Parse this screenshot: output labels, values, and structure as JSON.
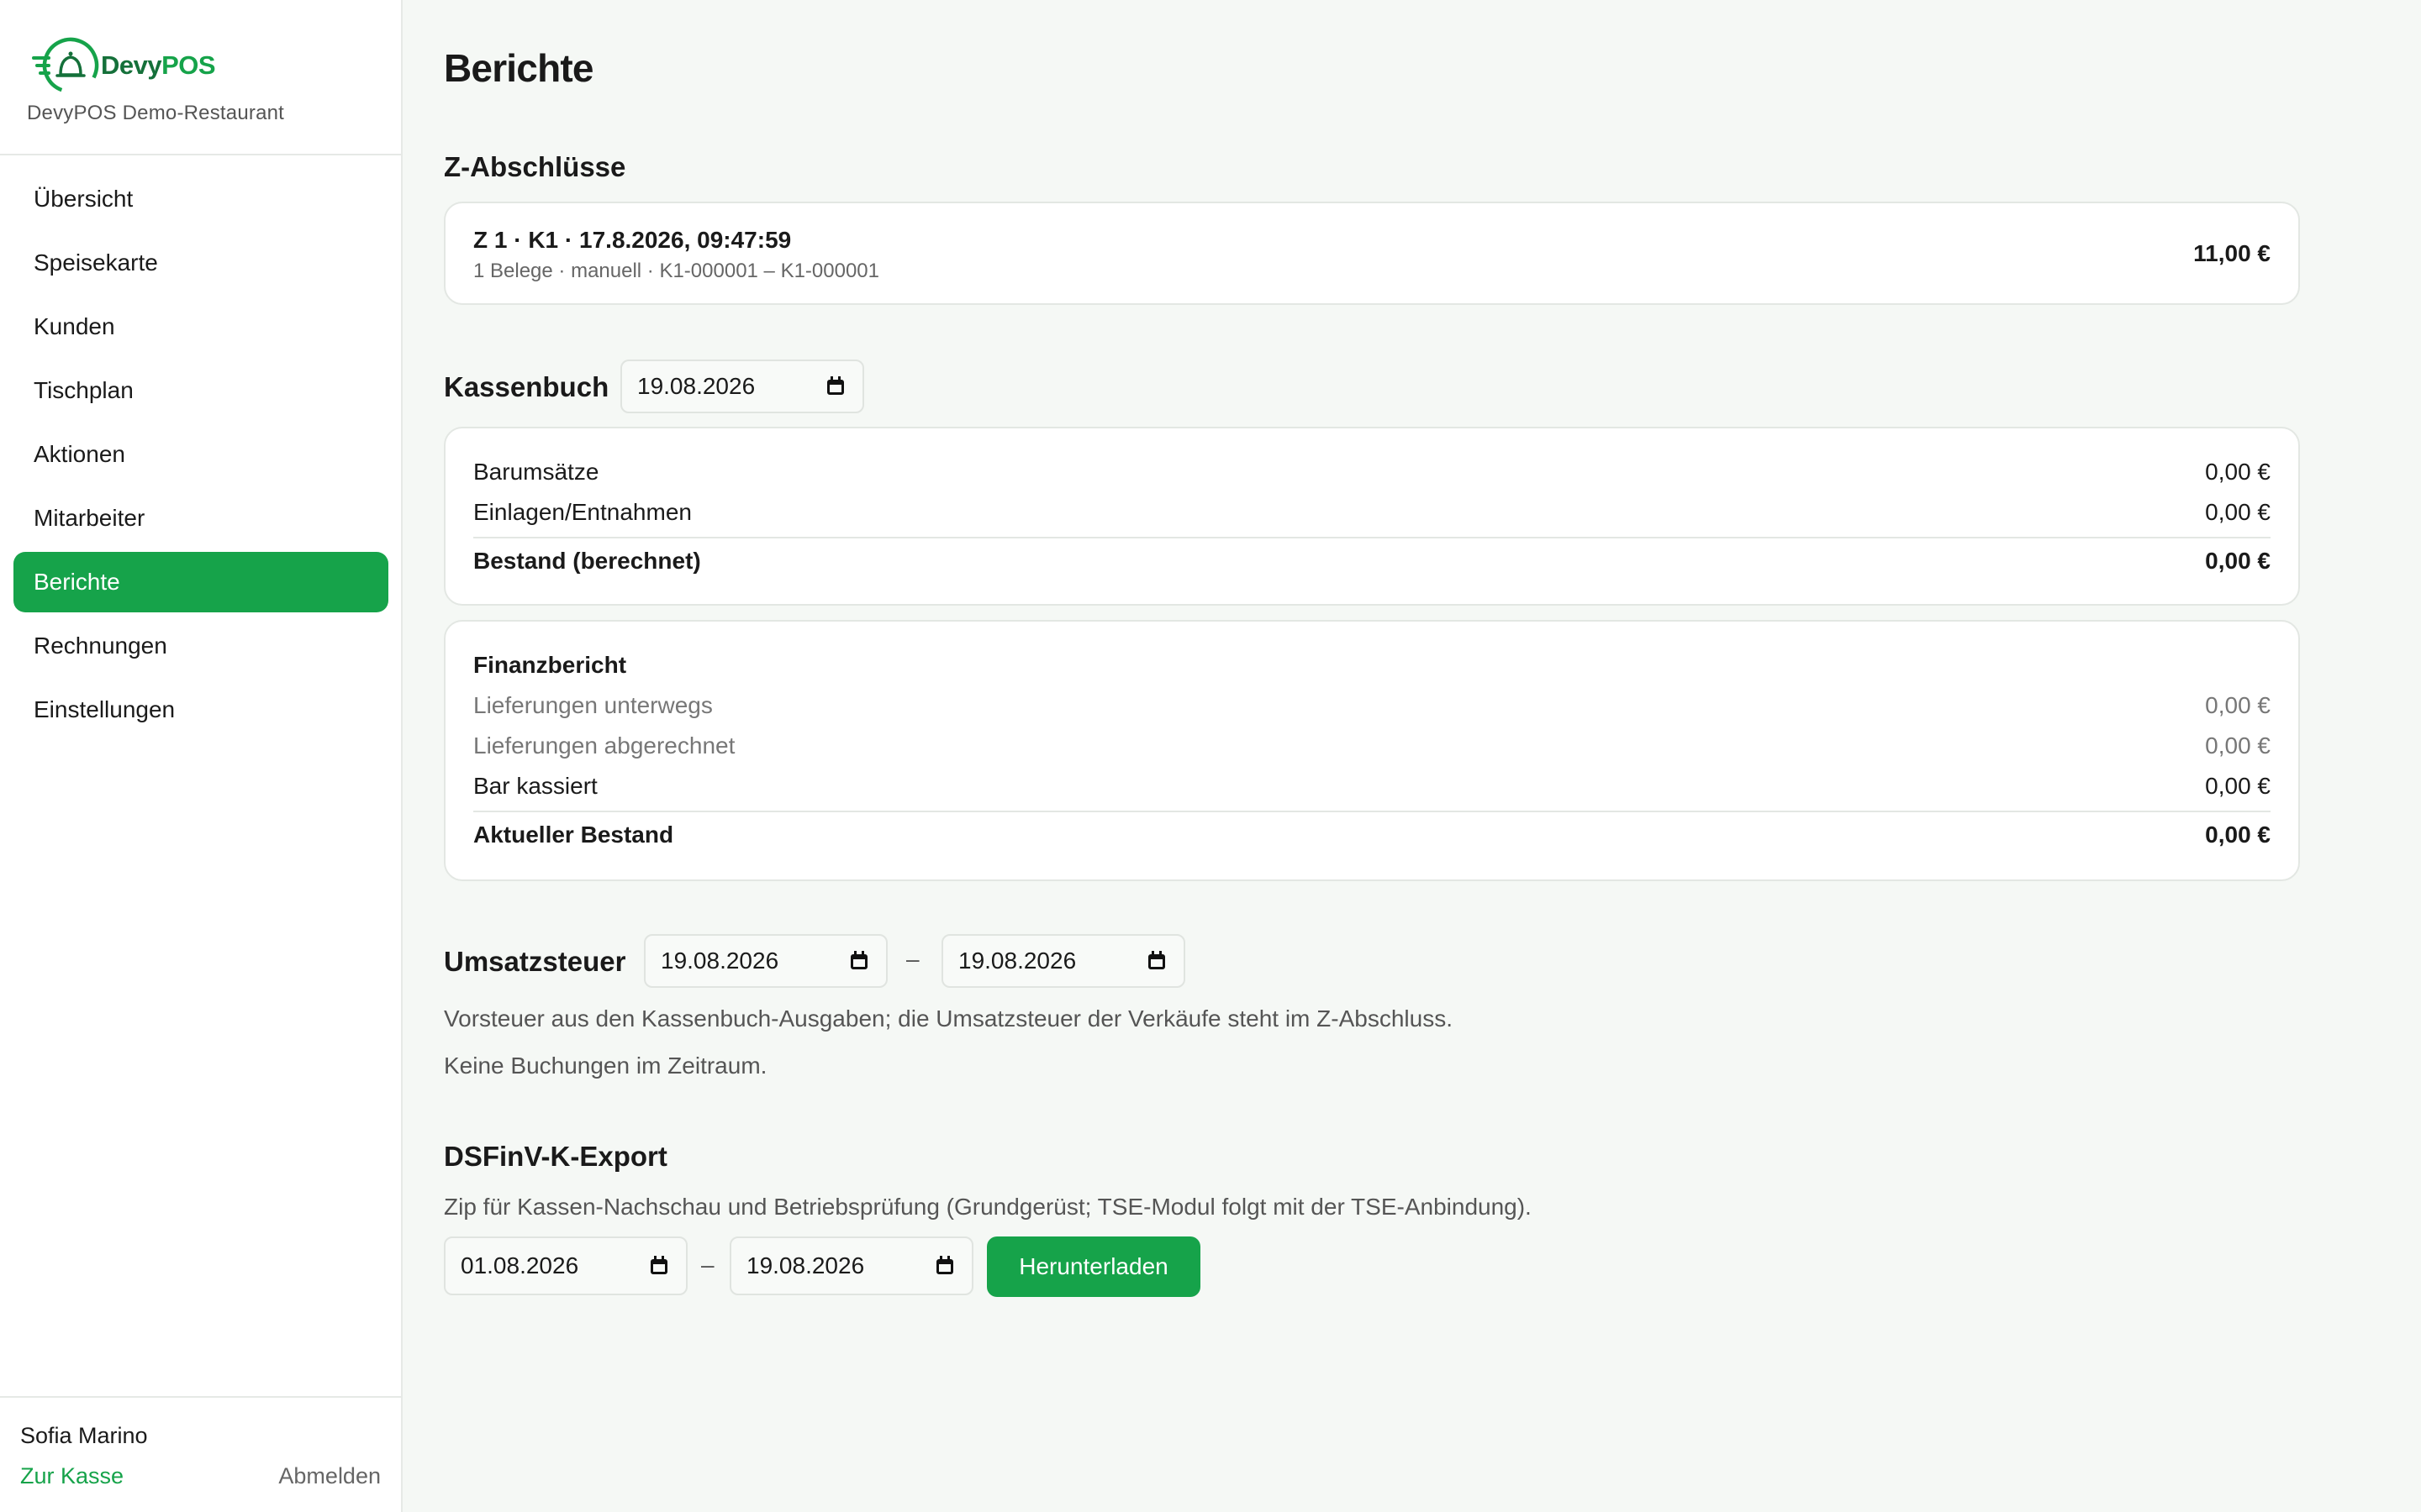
{
  "sidebar": {
    "brand_dark": "Devy",
    "brand_green": "POS",
    "restaurant": "DevyPOS Demo-Restaurant",
    "items": [
      {
        "label": "Übersicht"
      },
      {
        "label": "Speisekarte"
      },
      {
        "label": "Kunden"
      },
      {
        "label": "Tischplan"
      },
      {
        "label": "Aktionen"
      },
      {
        "label": "Mitarbeiter"
      },
      {
        "label": "Berichte",
        "active": true
      },
      {
        "label": "Rechnungen"
      },
      {
        "label": "Einstellungen"
      }
    ],
    "user_name": "Sofia Marino",
    "to_pos": "Zur Kasse",
    "logout": "Abmelden"
  },
  "page": {
    "title": "Berichte"
  },
  "z_reports": {
    "heading": "Z-Abschlüsse",
    "entries": [
      {
        "title": "Z 1 · K1 · 17.8.2026, 09:47:59",
        "meta": "1 Belege · manuell · K1-000001 – K1-000001",
        "amount": "11,00 €"
      }
    ]
  },
  "cashbook": {
    "heading": "Kassenbuch",
    "date": "19.08.2026",
    "rows": [
      {
        "label": "Barumsätze",
        "value": "0,00 €"
      },
      {
        "label": "Einlagen/Entnahmen",
        "value": "0,00 €"
      }
    ],
    "total_label": "Bestand (berechnet)",
    "total_value": "0,00 €"
  },
  "finance": {
    "heading": "Finanzbericht",
    "rows": [
      {
        "label": "Lieferungen unterwegs",
        "value": "0,00 €",
        "muted": true
      },
      {
        "label": "Lieferungen abgerechnet",
        "value": "0,00 €",
        "muted": true
      },
      {
        "label": "Bar kassiert",
        "value": "0,00 €",
        "muted": false
      }
    ],
    "total_label": "Aktueller Bestand",
    "total_value": "0,00 €"
  },
  "vat": {
    "heading": "Umsatzsteuer",
    "from": "19.08.2026",
    "separator": "–",
    "to": "19.08.2026",
    "note": "Vorsteuer aus den Kassenbuch-Ausgaben; die Umsatzsteuer der Verkäufe steht im Z-Abschluss.",
    "empty": "Keine Buchungen im Zeitraum."
  },
  "export": {
    "heading": "DSFinV-K-Export",
    "note": "Zip für Kassen-Nachschau und Betriebsprüfung (Grundgerüst; TSE-Modul folgt mit der TSE-Anbindung).",
    "from": "01.08.2026",
    "separator": "–",
    "to": "19.08.2026",
    "button": "Herunterladen"
  },
  "colors": {
    "accent": "#16a34a",
    "brand_dark": "#15703a",
    "background": "#f5f8f5"
  },
  "icons": {
    "logo": "bell-logo-icon",
    "date": "calendar-icon"
  }
}
